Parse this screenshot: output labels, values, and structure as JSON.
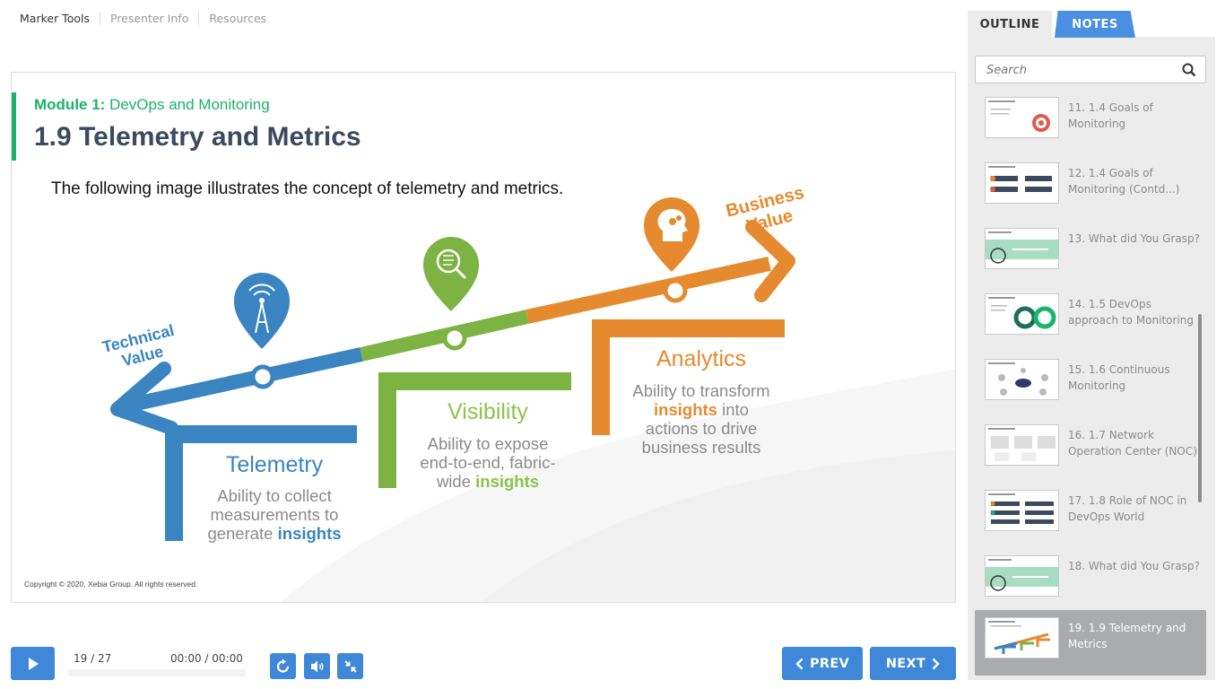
{
  "top_menu": {
    "items": [
      "Marker Tools",
      "Presenter Info",
      "Resources"
    ]
  },
  "slide": {
    "module_prefix": "Module 1:",
    "module_name": " DevOps and Monitoring",
    "title": "1.9 Telemetry and Metrics",
    "intro": "The following image illustrates the concept of telemetry and metrics.",
    "copyright": "Copyright © 2020, Xebia Group. All rights reserved.",
    "graphic": {
      "technical_value": [
        "Technical",
        "Value"
      ],
      "business_value": [
        "Business",
        "Value"
      ],
      "telemetry": {
        "heading": "Telemetry",
        "lines": [
          "Ability to collect",
          "measurements to",
          "generate "
        ],
        "emphasis": "insights",
        "color": "#3a84c2"
      },
      "visibility": {
        "heading": "Visibility",
        "lines": [
          "Ability to expose",
          "end-to-end, fabric-",
          "wide "
        ],
        "emphasis": "insights",
        "color": "#7cb342"
      },
      "analytics": {
        "heading": "Analytics",
        "lines": [
          "Ability to transform",
          " into",
          "actions to drive",
          "business results"
        ],
        "emphasis": "insights",
        "color": "#e58a2e"
      }
    }
  },
  "player": {
    "counter": "19 / 27",
    "time": "00:00 / 00:00",
    "prev_label": "PREV",
    "next_label": "NEXT",
    "accent_color": "#3f87d9"
  },
  "sidebar": {
    "tabs": {
      "outline": "OUTLINE",
      "notes": "NOTES"
    },
    "search_placeholder": "Search",
    "items": [
      {
        "label": "11. 1.4 Goals of Monitoring"
      },
      {
        "label": "12. 1.4 Goals of Monitoring (Contd...)"
      },
      {
        "label": "13. What did You Grasp?"
      },
      {
        "label": "14. 1.5 DevOps approach to Monitoring"
      },
      {
        "label": "15. 1.6 Continuous Monitoring"
      },
      {
        "label": "16. 1.7 Network Operation Center (NOC)"
      },
      {
        "label": "17. 1.8 Role of NOC in DevOps World"
      },
      {
        "label": "18. What did You Grasp?"
      },
      {
        "label": "19. 1.9 Telemetry and Metrics",
        "active": true
      }
    ]
  }
}
